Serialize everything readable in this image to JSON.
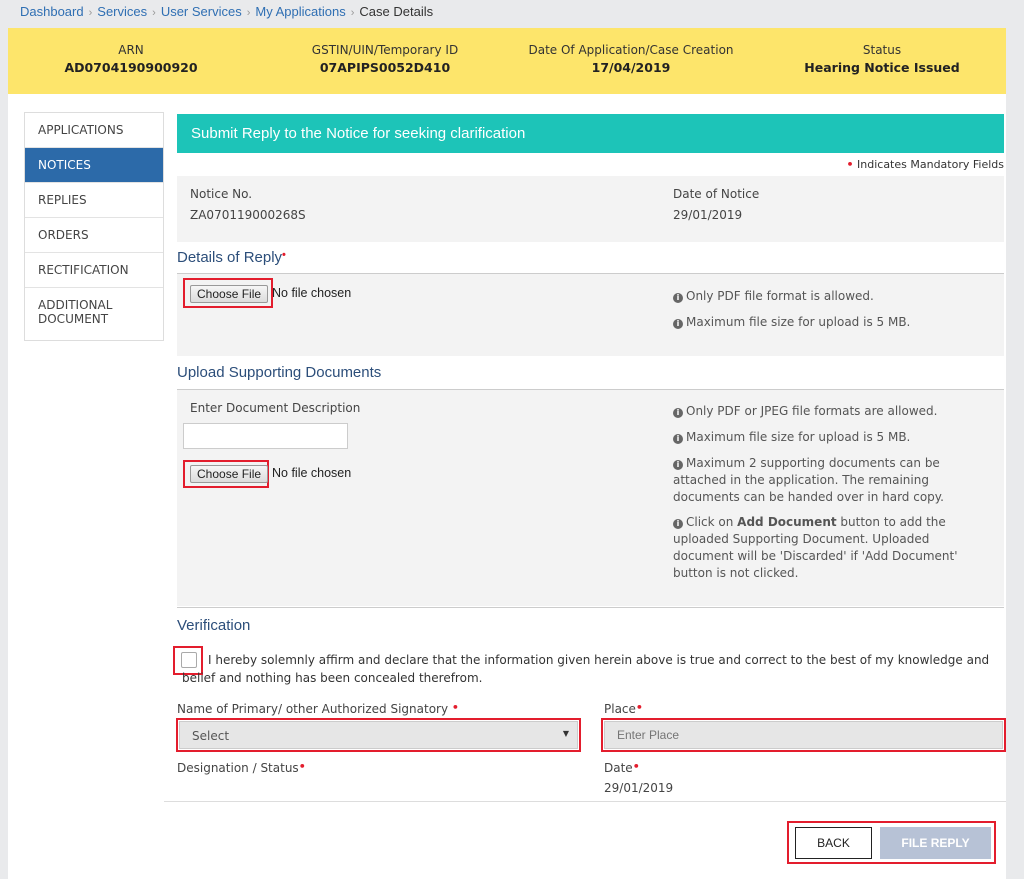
{
  "breadcrumb": {
    "items": [
      "Dashboard",
      "Services",
      "User Services",
      "My Applications"
    ],
    "current": "Case Details"
  },
  "infobar": {
    "arn_label": "ARN",
    "arn_value": "AD0704190900920",
    "gstin_label": "GSTIN/UIN/Temporary ID",
    "gstin_value": "07APIPS0052D410",
    "date_label": "Date Of Application/Case Creation",
    "date_value": "17/04/2019",
    "status_label": "Status",
    "status_value": "Hearing Notice Issued"
  },
  "sidebar": {
    "items": [
      {
        "label": "APPLICATIONS"
      },
      {
        "label": "NOTICES"
      },
      {
        "label": "REPLIES"
      },
      {
        "label": "ORDERS"
      },
      {
        "label": "RECTIFICATION"
      },
      {
        "label": "ADDITIONAL DOCUMENT"
      }
    ],
    "active": "NOTICES"
  },
  "main": {
    "header": "Submit Reply to the Notice for seeking clarification",
    "mandatory_note": "Indicates Mandatory Fields",
    "notice_no_label": "Notice No.",
    "notice_no_value": "ZA070119000268S",
    "notice_date_label": "Date of Notice",
    "notice_date_value": "29/01/2019",
    "reply_title": "Details of Reply",
    "choose_file": "Choose File",
    "no_file": "No file chosen",
    "reply_hint1": "Only PDF file format is allowed.",
    "reply_hint2": "Maximum file size for upload is 5 MB.",
    "support_title": "Upload Supporting Documents",
    "doc_desc_label": "Enter Document Description",
    "doc_desc_value": "",
    "support_hint1": "Only PDF or JPEG file formats are allowed.",
    "support_hint2": "Maximum file size for upload is 5 MB.",
    "support_hint3": "Maximum 2 supporting documents can be attached in the application. The remaining documents can be handed over in hard copy.",
    "support_hint4_pre": "Click on ",
    "support_hint4_bold": "Add Document",
    "support_hint4_post": " button to add the uploaded Supporting Document. Uploaded document will be 'Discarded' if 'Add Document' button is not clicked.",
    "verification_title": "Verification",
    "declaration": "I hereby solemnly affirm and declare that the information given herein above is true and correct to the best of my knowledge and belief and nothing has been concealed therefrom.",
    "signatory_label": "Name of Primary/ other Authorized Signatory",
    "signatory_selected": "Select",
    "place_label": "Place",
    "place_placeholder": "Enter Place",
    "designation_label": "Designation / Status",
    "date_label": "Date",
    "date_value": "29/01/2019",
    "back_button": "BACK",
    "file_reply_button": "FILE REPLY"
  },
  "colors": {
    "infobar_bg": "#fde56b",
    "header_teal": "#1dc4b8",
    "sidebar_active": "#2c6aa9",
    "highlight_red": "#e31d2d",
    "disabled_button": "#b7c2d6"
  }
}
